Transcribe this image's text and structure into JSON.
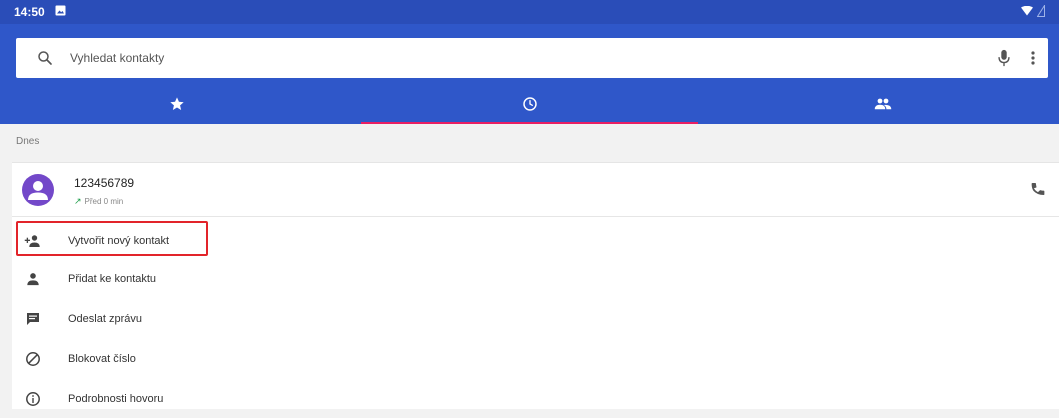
{
  "status_bar": {
    "time": "14:50"
  },
  "search": {
    "placeholder": "Vyhledat kontakty"
  },
  "tabs": [
    {
      "icon": "star-icon",
      "active": false
    },
    {
      "icon": "clock-icon",
      "active": true
    },
    {
      "icon": "people-icon",
      "active": false
    }
  ],
  "section": {
    "label": "Dnes"
  },
  "call": {
    "number": "123456789",
    "meta": "Před 0 min"
  },
  "actions": [
    {
      "icon": "person-add-icon",
      "label": "Vytvořit nový kontakt"
    },
    {
      "icon": "person-icon",
      "label": "Přidat ke kontaktu"
    },
    {
      "icon": "message-icon",
      "label": "Odeslat zprávu"
    },
    {
      "icon": "block-icon",
      "label": "Blokovat číslo"
    },
    {
      "icon": "info-icon",
      "label": "Podrobnosti hovoru"
    }
  ],
  "colors": {
    "app_bar": "#2f57c9",
    "status_bar": "#2a4db8",
    "tab_indicator": "#e91e63",
    "avatar": "#7348c9",
    "highlight": "#e2242a"
  }
}
